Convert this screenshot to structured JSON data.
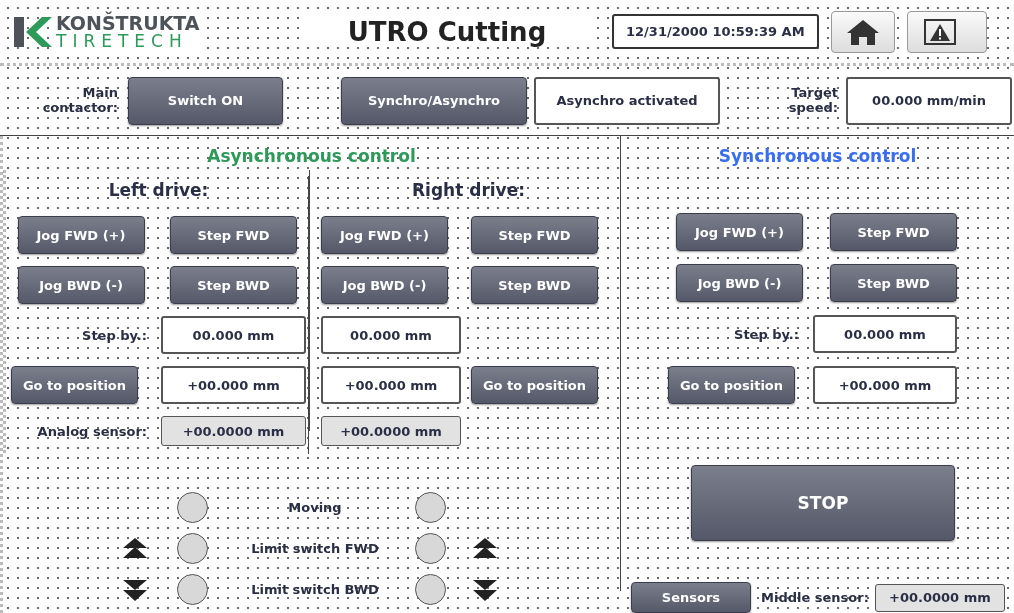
{
  "header": {
    "logo": {
      "line1": "KONŠTRUKTA",
      "line2": "TIRETECH"
    },
    "title": "UTRO Cutting",
    "datetime": "12/31/2000 10:59:39 AM"
  },
  "toolbar": {
    "main_contactor_label": [
      "Main",
      "contactor:"
    ],
    "switch_button": "Switch ON",
    "mode_button": "Synchro/Asynchro",
    "mode_status": "Asynchro activated",
    "target_speed_label": [
      "Target",
      "speed:"
    ],
    "target_speed": "00.000 mm/min"
  },
  "async": {
    "title": "Asynchronous control",
    "drives": [
      {
        "kind": "left",
        "heading": "Left drive:",
        "jog_fwd": "Jog FWD (+)",
        "step_fwd": "Step FWD",
        "jog_bwd": "Jog BWD (-)",
        "step_bwd": "Step BWD",
        "step_by_label": "Step by.:",
        "step_by": "00.000 mm",
        "go_button": "Go to position",
        "position": "+00.000 mm",
        "sensor_label": "Analog sensor:",
        "sensor": "+00.0000 mm"
      },
      {
        "kind": "right",
        "heading": "Right drive:",
        "jog_fwd": "Jog FWD (+)",
        "step_fwd": "Step FWD",
        "jog_bwd": "Jog BWD (-)",
        "step_bwd": "Step BWD",
        "step_by": "00.000 mm",
        "go_button": "Go to position",
        "position": "+00.000 mm",
        "sensor": "+00.0000 mm"
      }
    ]
  },
  "indicators": [
    {
      "kind": "plain",
      "label": "Moving",
      "left_on": false,
      "right_on": false
    },
    {
      "kind": "fwd",
      "label": "Limit switch FWD",
      "left_on": false,
      "right_on": false
    },
    {
      "kind": "bwd",
      "label": "Limit switch BWD",
      "left_on": false,
      "right_on": false
    }
  ],
  "sync": {
    "title": "Synchronous control",
    "jog_fwd": "Jog FWD (+)",
    "step_fwd": "Step FWD",
    "jog_bwd": "Jog BWD (-)",
    "step_bwd": "Step BWD",
    "step_by_label": "Step by.:",
    "step_by": "00.000 mm",
    "go_button": "Go to position",
    "position": "+00.000 mm",
    "stop_button": "STOP"
  },
  "bottom": {
    "sensors_button": "Sensors",
    "middle_sensor_label": "Middle sensor:",
    "middle_sensor": "+00.0000 mm"
  }
}
